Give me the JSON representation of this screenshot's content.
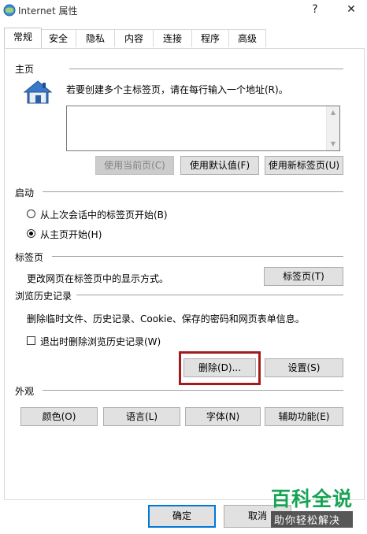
{
  "window": {
    "title": "Internet 属性",
    "help_label": "?",
    "close_label": "✕"
  },
  "tabs": [
    {
      "label": "常规",
      "active": true
    },
    {
      "label": "安全"
    },
    {
      "label": "隐私"
    },
    {
      "label": "内容"
    },
    {
      "label": "连接"
    },
    {
      "label": "程序"
    },
    {
      "label": "高级"
    }
  ],
  "home": {
    "header": "主页",
    "description": "若要创建多个主标签页，请在每行输入一个地址(R)。",
    "buttons": {
      "use_current": "使用当前页(C)",
      "use_default": "使用默认值(F)",
      "use_new_tab": "使用新标签页(U)"
    }
  },
  "startup": {
    "header": "启动",
    "options": [
      {
        "label": "从上次会话中的标签页开始(B)",
        "selected": false
      },
      {
        "label": "从主页开始(H)",
        "selected": true
      }
    ]
  },
  "tabs_section": {
    "header": "标签页",
    "description": "更改网页在标签页中的显示方式。",
    "button": "标签页(T)"
  },
  "history": {
    "header": "浏览历史记录",
    "description": "删除临时文件、历史记录、Cookie、保存的密码和网页表单信息。",
    "checkbox_label": "退出时删除浏览历史记录(W)",
    "checkbox_checked": false,
    "delete_button": "删除(D)...",
    "settings_button": "设置(S)"
  },
  "appearance": {
    "header": "外观",
    "buttons": {
      "colors": "颜色(O)",
      "languages": "语言(L)",
      "fonts": "字体(N)",
      "accessibility": "辅助功能(E)"
    }
  },
  "footer": {
    "ok": "确定",
    "cancel": "取消"
  },
  "watermark": {
    "main": "百科全说",
    "sub": "助你轻松解决"
  },
  "colors": {
    "accent": "#0078d7",
    "highlight_border": "#a11d1d",
    "watermark_green": "#17a354"
  }
}
